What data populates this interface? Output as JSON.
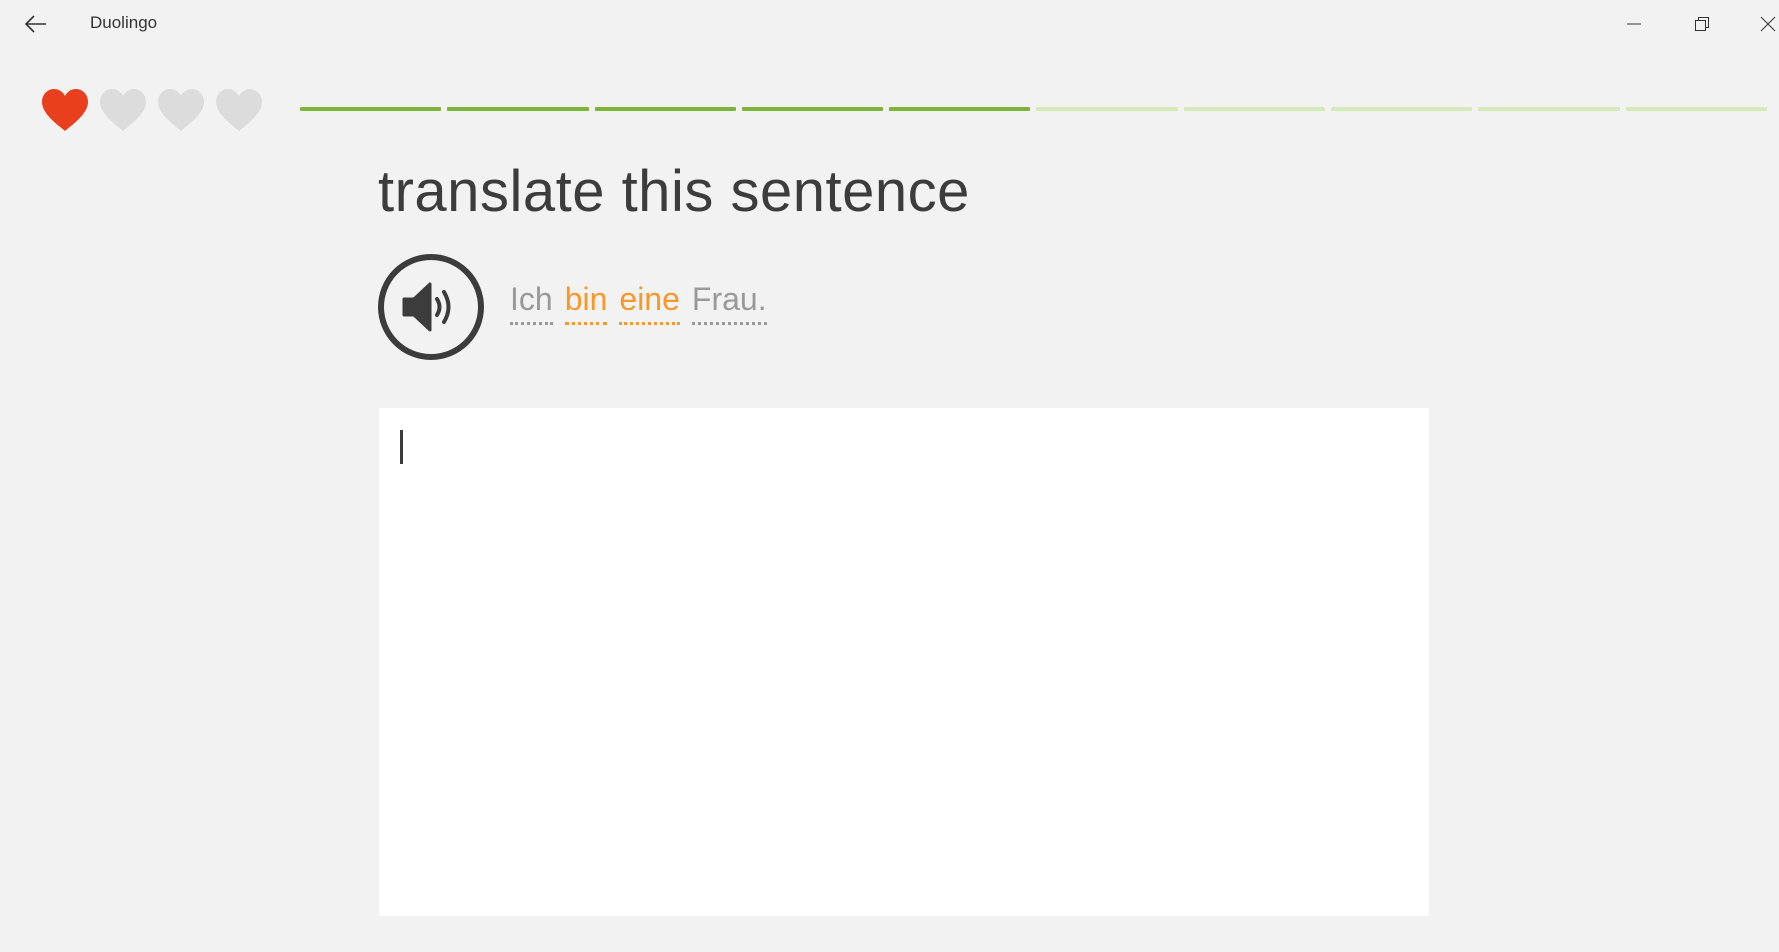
{
  "titlebar": {
    "app_title": "Duolingo",
    "back_icon": "back-arrow-icon",
    "minimize_icon": "minimize-icon",
    "restore_icon": "restore-icon",
    "close_icon": "close-icon"
  },
  "hearts": {
    "total": 4,
    "remaining": 1,
    "full_color": "#e8401c",
    "empty_color": "#dcdcdc"
  },
  "progress": {
    "total_segments": 10,
    "completed_segments": 5,
    "done_color": "#7eb536",
    "todo_color": "#d6e9b8"
  },
  "exercise": {
    "prompt": "translate this sentence",
    "speaker_icon": "speaker-icon",
    "sentence_words": [
      {
        "text": "Ich",
        "new": false
      },
      {
        "text": "bin",
        "new": true
      },
      {
        "text": "eine",
        "new": true
      },
      {
        "text": "Frau.",
        "new": false
      }
    ],
    "answer_value": "",
    "new_word_color": "#f5992b",
    "known_word_color": "#999999"
  }
}
